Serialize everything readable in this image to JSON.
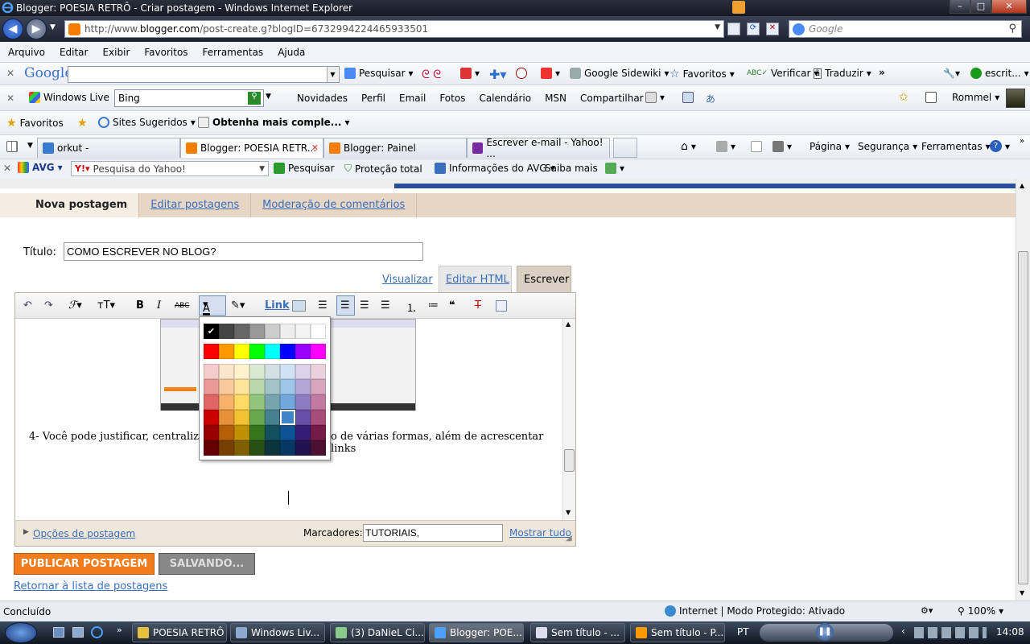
{
  "window": {
    "title": "Blogger: POESIA RETRÔ - Criar postagem - Windows Internet Explorer"
  },
  "address": {
    "url_prefix": "http://www.",
    "url_domain": "blogger.com",
    "url_path": "/post-create.g?blogID=6732994224465933501",
    "search_placeholder": "Google"
  },
  "menu": [
    "Arquivo",
    "Editar",
    "Exibir",
    "Favoritos",
    "Ferramentas",
    "Ajuda"
  ],
  "google_toolbar": {
    "logo": "Google",
    "search": "Pesquisar",
    "sidewiki": "Google Sidewiki",
    "favorites": "Favoritos",
    "check": "Verificar",
    "translate": "Traduzir",
    "more": "»",
    "user": "escrit..."
  },
  "live_toolbar": {
    "brand": "Windows Live",
    "search_value": "Bing",
    "links": [
      "Novidades",
      "Perfil",
      "Email",
      "Fotos",
      "Calendário",
      "MSN",
      "Compartilhar"
    ],
    "user": "Rommel"
  },
  "fav_bar": {
    "favorites": "Favoritos",
    "suggested": "Sites Sugeridos",
    "more": "Obtenha mais comple..."
  },
  "tabs": [
    {
      "label": "orkut -",
      "active": false
    },
    {
      "label": "Blogger: POESIA RETR...",
      "active": true
    },
    {
      "label": "Blogger: Painel",
      "active": false
    },
    {
      "label": "Escrever e-mail - Yahoo! ...",
      "active": false
    }
  ],
  "command_bar": {
    "page": "Página",
    "security": "Segurança",
    "tools": "Ferramentas"
  },
  "avg_bar": {
    "brand": "AVG",
    "yahoo_placeholder": "Pesquisa do Yahoo!",
    "search": "Pesquisar",
    "protection": "Proteção total",
    "info": "Informações do AVG",
    "learn": "Saiba mais"
  },
  "blogger": {
    "nav_tabs": [
      "Nova postagem",
      "Editar postagens",
      "Moderação de comentários"
    ],
    "title_label": "Título:",
    "title_value": "COMO ESCREVER NO BLOG?",
    "mode_tabs": {
      "preview": "Visualizar",
      "html": "Editar HTML",
      "compose": "Escrever"
    },
    "toolbar": {
      "link": "Link"
    },
    "body_text": "4- Você pode justificar, centralizar",
    "body_text_right": "o de várias formas, além de acrescentar links",
    "options_link": "Opções de postagem",
    "labels_label": "Marcadores:",
    "labels_value": "TUTORIAIS,",
    "show_all": "Mostrar tudo",
    "publish": "PUBLICAR POSTAGEM",
    "saving": "SALVANDO...",
    "back": "Retornar à lista de postagens"
  },
  "palette": {
    "row1": [
      "#000000",
      "#444444",
      "#666666",
      "#999999",
      "#cccccc",
      "#eeeeee",
      "#f3f3f3",
      "#ffffff"
    ],
    "row2": [
      "#ff0000",
      "#ff9900",
      "#ffff00",
      "#00ff00",
      "#00ffff",
      "#0000ff",
      "#9900ff",
      "#ff00ff"
    ],
    "rows": [
      [
        "#f4cccc",
        "#fce5cd",
        "#fff2cc",
        "#d9ead3",
        "#d0e0e3",
        "#cfe2f3",
        "#d9d2e9",
        "#ead1dc"
      ],
      [
        "#ea9999",
        "#f9cb9c",
        "#ffe599",
        "#b6d7a8",
        "#a2c4c9",
        "#9fc5e8",
        "#b4a7d6",
        "#d5a6bd"
      ],
      [
        "#e06666",
        "#f6b26b",
        "#ffd966",
        "#93c47d",
        "#76a5af",
        "#6fa8dc",
        "#8e7cc3",
        "#c27ba0"
      ],
      [
        "#cc0000",
        "#e69138",
        "#f1c232",
        "#6aa84f",
        "#45818e",
        "#3d85c6",
        "#674ea7",
        "#a64d79"
      ],
      [
        "#990000",
        "#b45f06",
        "#bf9000",
        "#38761d",
        "#134f5c",
        "#0b5394",
        "#351c75",
        "#741b47"
      ],
      [
        "#660000",
        "#783f04",
        "#7f6000",
        "#274e13",
        "#0c343d",
        "#073763",
        "#20124d",
        "#4c1130"
      ]
    ]
  },
  "status": {
    "left": "Concluído",
    "zone": "Internet | Modo Protegido: Ativado",
    "zoom": "100%"
  },
  "taskbar": {
    "items": [
      "POESIA RETRÔ",
      "Windows Liv...",
      "(3) DaNieL Ci...",
      "Blogger: POE...",
      "Sem título - ...",
      "Sem título - P..."
    ],
    "lang": "PT",
    "clock": "14:08"
  }
}
